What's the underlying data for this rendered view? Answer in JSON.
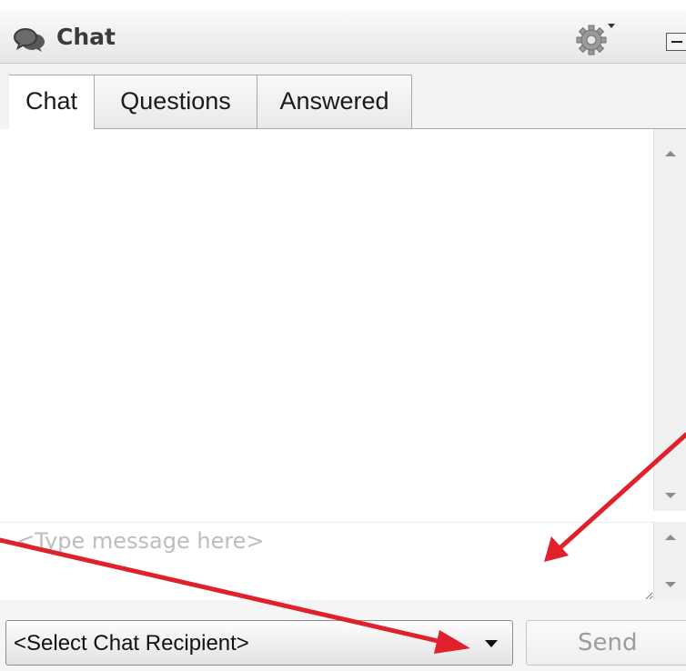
{
  "window": {
    "title": "Chat"
  },
  "tabs": [
    {
      "label": "Chat",
      "active": true
    },
    {
      "label": "Questions",
      "active": false
    },
    {
      "label": "Answered",
      "active": false
    }
  ],
  "composer": {
    "placeholder": "<Type message here>",
    "value": ""
  },
  "recipient": {
    "selected": "<Select Chat Recipient>"
  },
  "send_button": {
    "label": "Send",
    "enabled": false
  },
  "icons": {
    "title": "chat-bubbles-icon",
    "settings": "gear-icon",
    "minimize": "minimize-icon",
    "dropdown": "chevron-down-icon"
  },
  "colors": {
    "annotation_arrow": "#e0202a",
    "title_text": "#3a3a3a",
    "disabled_text": "#9c9c9c"
  }
}
